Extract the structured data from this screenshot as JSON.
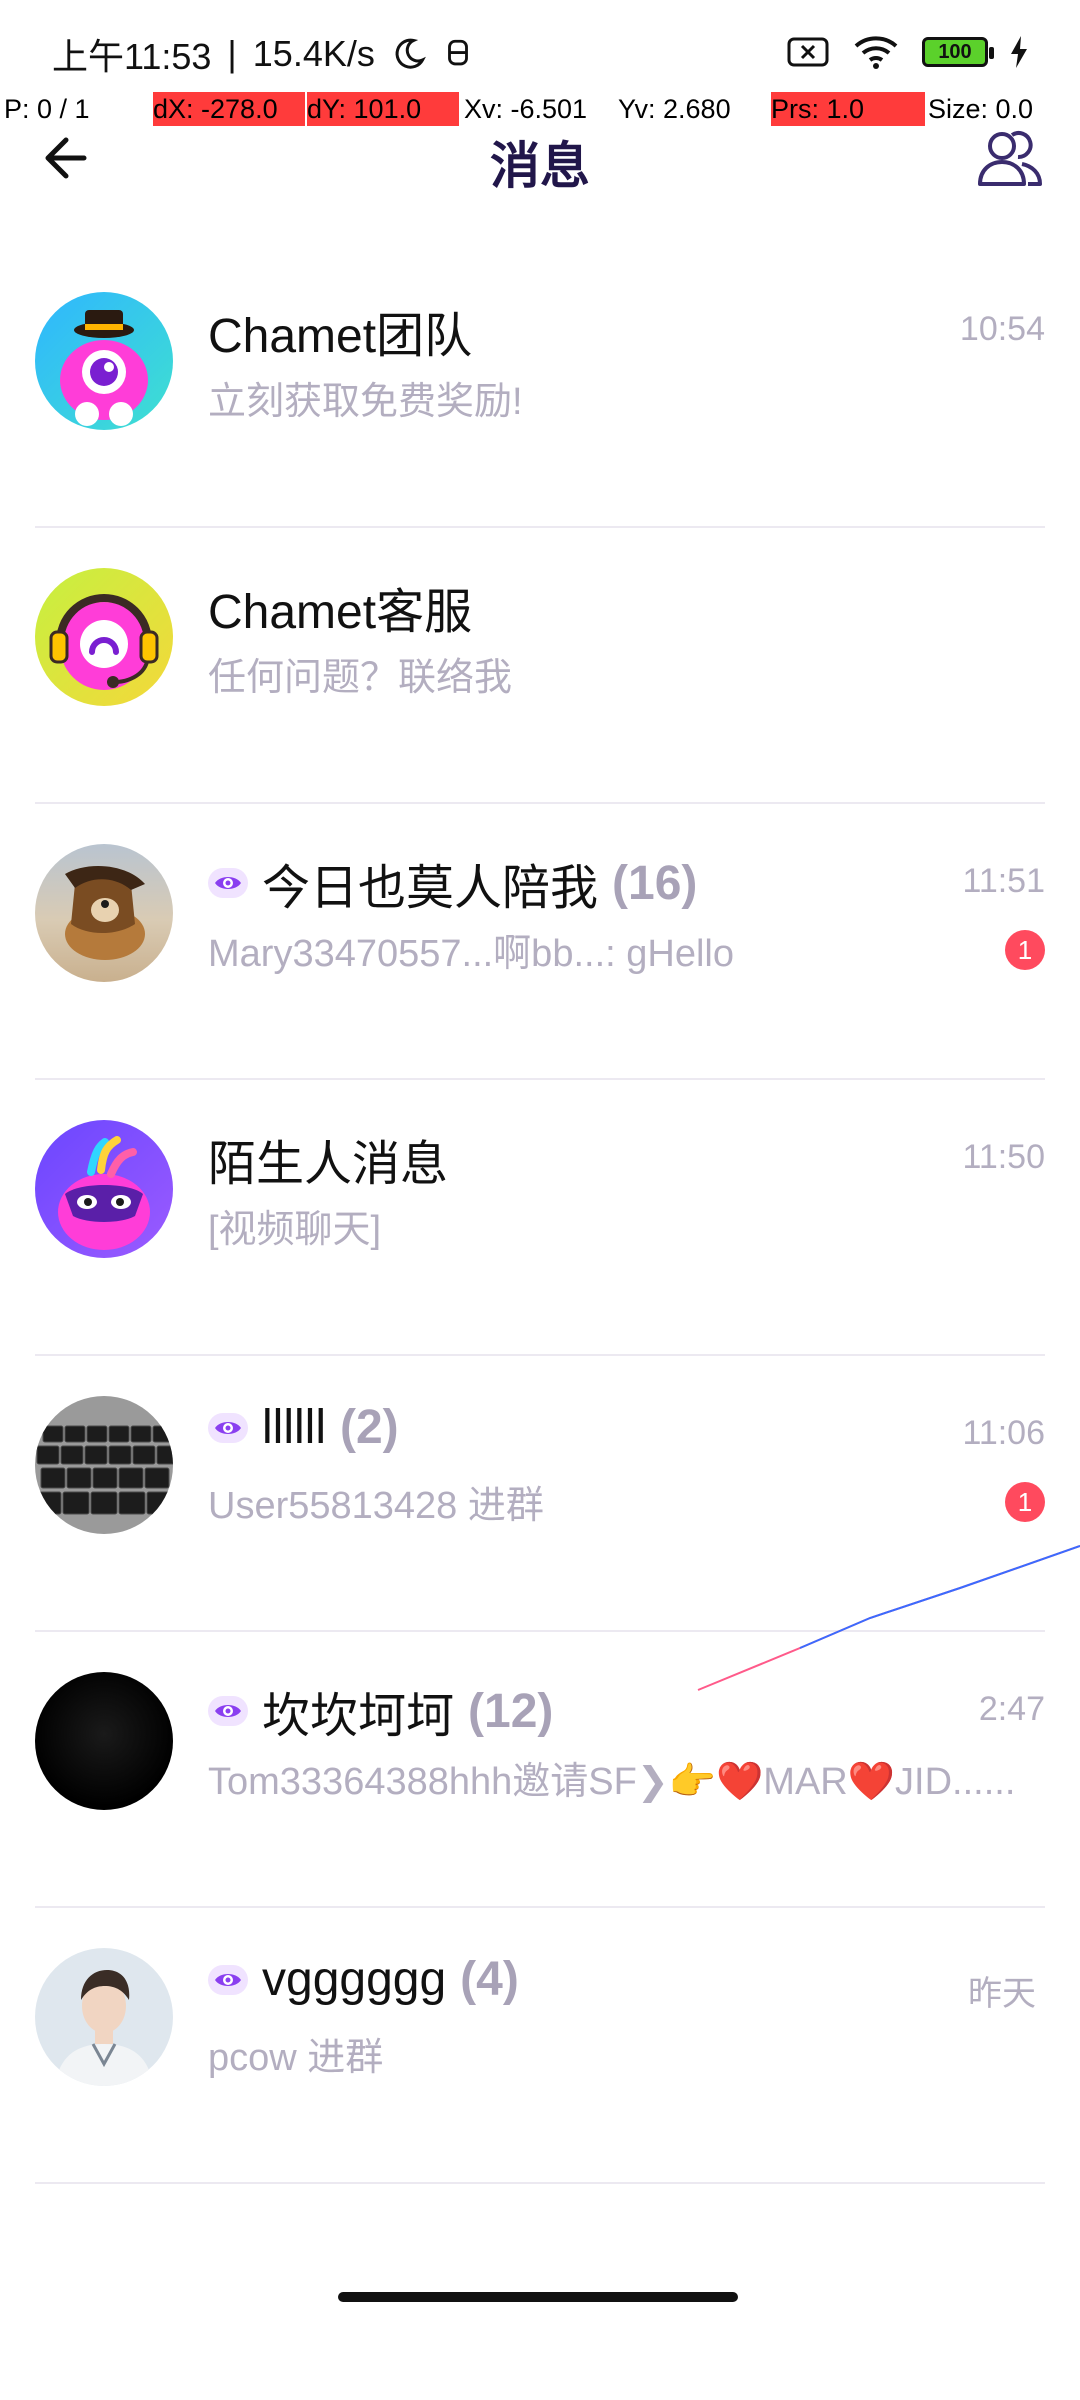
{
  "status_bar": {
    "time": "上午11:53",
    "separator": "|",
    "net_speed": "15.4K/s",
    "battery_level": "100"
  },
  "debug": {
    "pointer": "P: 0 / 1",
    "dx": "dX: -278.0",
    "dy": "dY: 101.0",
    "xv": "Xv: -6.501",
    "yv": "Yv: 2.680",
    "prs": "Prs: 1.0",
    "size": "Size: 0.0"
  },
  "header": {
    "title": "消息"
  },
  "conversations": [
    {
      "name": "Chamet团队",
      "count": "",
      "preview": "立刻获取免费奖励!",
      "time": "10:54",
      "badge": "",
      "has_eye": false,
      "avatar": "chamet-team-mascot"
    },
    {
      "name": "Chamet客服",
      "count": "",
      "preview": "任何问题？联络我",
      "time": "",
      "badge": "",
      "has_eye": false,
      "avatar": "chamet-support-mascot"
    },
    {
      "name": "今日也莫人陪我",
      "count": "(16)",
      "preview": "Mary33470557...啊bb...: gHello",
      "time": "11:51",
      "badge": "1",
      "has_eye": true,
      "avatar": "dog-photo"
    },
    {
      "name": "陌生人消息",
      "count": "",
      "preview": "[视频聊天]",
      "time": "11:50",
      "badge": "",
      "has_eye": false,
      "avatar": "stranger-mask-mascot"
    },
    {
      "name": "llllll",
      "count": "(2)",
      "preview": "User55813428 进群",
      "time": "11:06",
      "badge": "1",
      "has_eye": true,
      "avatar": "keyboard-photo"
    },
    {
      "name": "坎坎坷坷",
      "count": "(12)",
      "preview": "Tom33364388hhh邀请SF❯👉❤️MAR❤️JID......",
      "time": "2:47",
      "badge": "",
      "has_eye": true,
      "avatar": "black-circle"
    },
    {
      "name": "vgggggg",
      "count": "(4)",
      "preview": "pcow 进群",
      "time": "昨天",
      "badge": "",
      "has_eye": true,
      "avatar": "person-photo"
    }
  ]
}
